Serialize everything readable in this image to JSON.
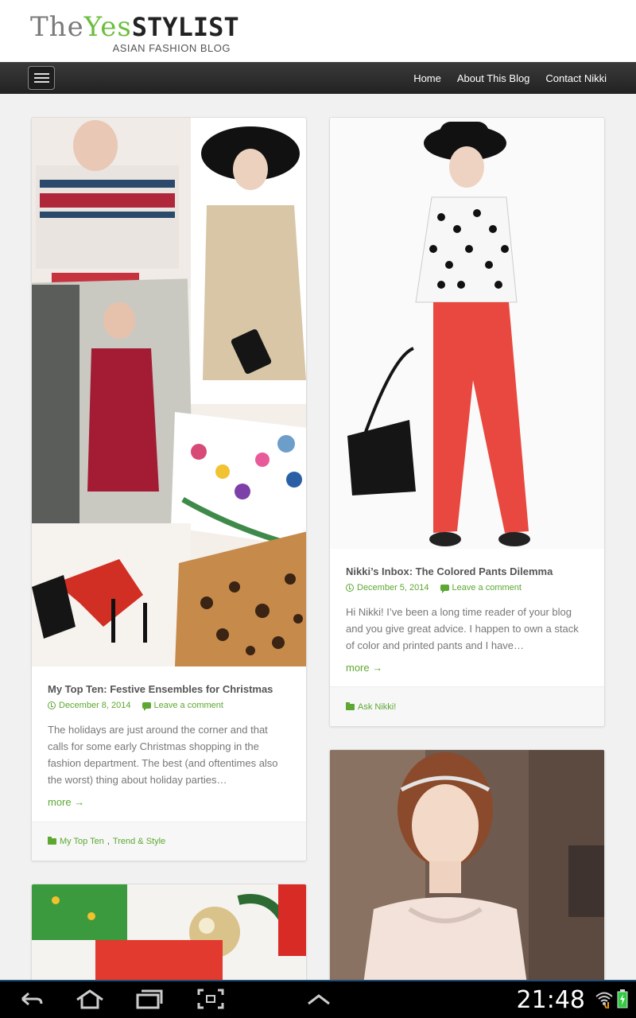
{
  "site": {
    "logo_the": "The",
    "logo_yes": "Yes",
    "logo_stylist": "STYLIST",
    "logo_tagline": "ASIAN FASHION BLOG"
  },
  "nav": {
    "links": [
      "Home",
      "About This Blog",
      "Contact Nikki"
    ]
  },
  "posts": [
    {
      "title": "My Top Ten: Festive Ensembles for Christmas",
      "date": "December 8, 2014",
      "comments": "Leave a comment",
      "excerpt": "The holidays are just around the corner and that calls for some early Christmas shopping in the fashion department. The best (and oftentimes also the worst) thing about holiday parties…",
      "more": "more",
      "categories": [
        "My Top Ten",
        "Trend & Style"
      ]
    },
    {
      "title": "Nikki’s Inbox: The Colored Pants Dilemma",
      "date": "December 5, 2014",
      "comments": "Leave a comment",
      "excerpt": "Hi Nikki! I’ve been a long time reader of your blog and you give great advice. I happen to own a stack of color and printed pants and I have…",
      "more": "more",
      "categories": [
        "Ask Nikki!"
      ]
    }
  ],
  "system_bar": {
    "time": "21:48",
    "icons": [
      "back-icon",
      "home-icon",
      "recent-apps-icon",
      "screenshot-icon",
      "up-arrow-icon",
      "wifi-icon",
      "battery-icon"
    ]
  },
  "colors": {
    "accent": "#5da832",
    "navbar": "#2b2b2b",
    "background": "#f1f1f1"
  }
}
